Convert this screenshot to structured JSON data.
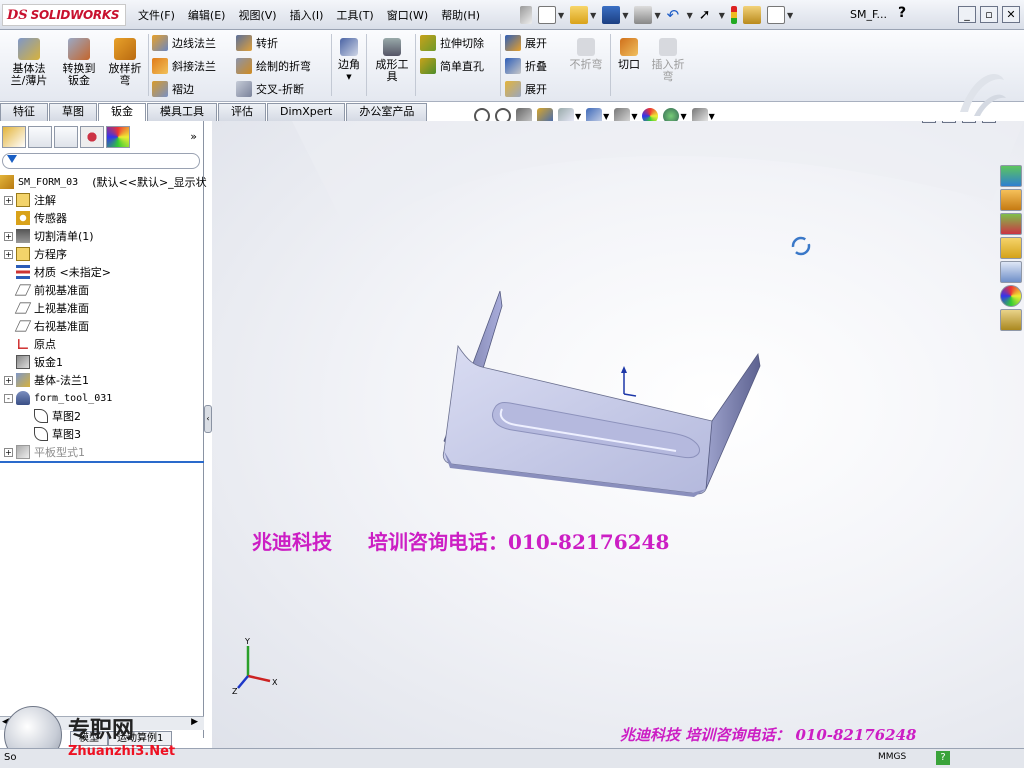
{
  "app": {
    "logo_ds": "DS",
    "logo_name": "SOLIDWORKS",
    "doc_title": "SM_F...",
    "help": "?"
  },
  "menu": [
    "文件(F)",
    "编辑(E)",
    "视图(V)",
    "插入(I)",
    "工具(T)",
    "窗口(W)",
    "帮助(H)"
  ],
  "ribbon": {
    "base_flange": "基体法\n兰/薄片",
    "convert_sheet": "转换到\n钣金",
    "lofted_bend": "放样折\n弯",
    "edge_flange": "边线法兰",
    "miter_flange": "斜接法兰",
    "hem": "褶边",
    "jog": "转折",
    "sketched_bend": "绘制的折弯",
    "cross_break": "交叉-折断",
    "corner": "边角",
    "forming_tool": "成形工\n具",
    "extruded_cut": "拉伸切除",
    "simple_hole": "简单直孔",
    "unfold": "展开",
    "fold": "折叠",
    "flatten": "展开",
    "no_bends": "不折弯",
    "rip": "切口",
    "insert_bends": "插入折\n弯"
  },
  "tabs": [
    "特征",
    "草图",
    "钣金",
    "模具工具",
    "评估",
    "DimXpert",
    "办公室产品"
  ],
  "tree": {
    "root": "SM_FORM_03",
    "root_config": "(默认<<默认>_显示状",
    "items": [
      {
        "label": "注解",
        "expand": "+"
      },
      {
        "label": "传感器",
        "expand": ""
      },
      {
        "label": "切割清单(1)",
        "expand": "+"
      },
      {
        "label": "方程序",
        "expand": "+"
      },
      {
        "label": "材质 <未指定>",
        "expand": ""
      },
      {
        "label": "前视基准面",
        "expand": ""
      },
      {
        "label": "上视基准面",
        "expand": ""
      },
      {
        "label": "右视基准面",
        "expand": ""
      },
      {
        "label": "原点",
        "expand": ""
      },
      {
        "label": "钣金1",
        "expand": ""
      },
      {
        "label": "基体-法兰1",
        "expand": "+"
      },
      {
        "label": "form_tool_031",
        "expand": "-"
      },
      {
        "label": "草图2",
        "expand": ""
      },
      {
        "label": "草图3",
        "expand": ""
      },
      {
        "label": "平板型式1",
        "expand": "+"
      }
    ]
  },
  "bottom_tabs": [
    "模型",
    "运动算例1"
  ],
  "status": {
    "left_text": "So",
    "units": "MMGS",
    "help_badge": "?"
  },
  "watermark": {
    "company": "兆迪科技",
    "phone_line": "培训咨询电话：010-82176248",
    "footer": "兆迪科技  培训咨询电话：  010-82176248",
    "brand": "专职网",
    "brand_net": "Zhuanzhi3.Net"
  },
  "axes": {
    "x": "X",
    "y": "Y",
    "z": "Z"
  },
  "colors": {
    "accent": "#2a6acb",
    "watermark": "#cc1ec4",
    "brand_red": "#c8102e"
  }
}
